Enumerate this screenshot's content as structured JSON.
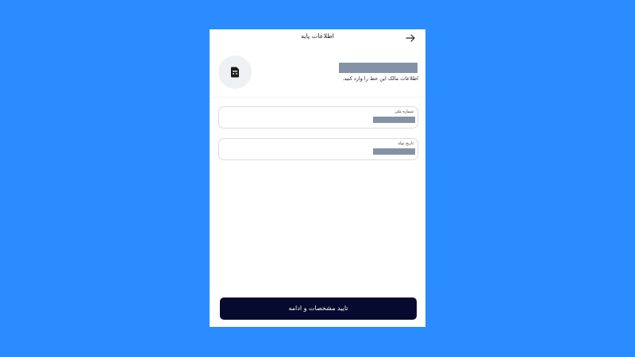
{
  "header": {
    "title": "اطلاعات پایه",
    "back_icon": "arrow-right-icon"
  },
  "owner": {
    "avatar_icon": "sim-card-icon",
    "hint": "اطلاعات مالک این خط را وارد کنید."
  },
  "form": {
    "national_id": {
      "label": "شماره ملی"
    },
    "birth_date": {
      "label": "تاریخ تولد"
    }
  },
  "actions": {
    "submit_label": "تایید مشخصات و ادامه"
  },
  "colors": {
    "background": "#2b8cff",
    "primary_button": "#050a2e",
    "redacted": "#8592a6"
  }
}
